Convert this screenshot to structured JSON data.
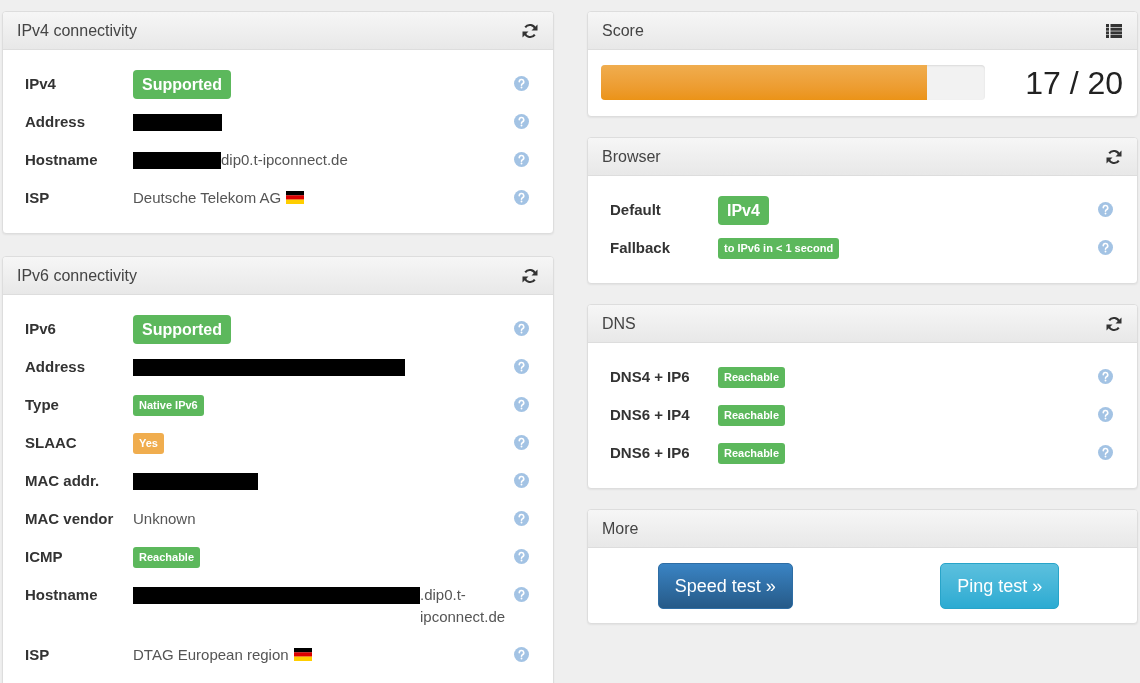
{
  "columns": [
    {
      "panels": [
        {
          "title": "IPv4 connectivity",
          "kind": "test",
          "rows": [
            {
              "label": "IPv4",
              "kind": "status",
              "value": "Supported",
              "color": "#5cb85c"
            },
            {
              "label": "Address",
              "kind": "masked"
            },
            {
              "label": "Hostname",
              "kind": "masked",
              "value": "dip0.t-ipconnect.de"
            },
            {
              "label": "ISP",
              "kind": "country",
              "value": "Deutsche Telekom AG"
            }
          ]
        },
        {
          "title": "IPv6 connectivity",
          "kind": "test",
          "rows": [
            {
              "label": "IPv6",
              "kind": "status",
              "value": "Supported",
              "color": "#5cb85c"
            },
            {
              "label": "Address",
              "kind": "masked"
            },
            {
              "label": "Type",
              "kind": "tag",
              "value": "Native IPv6",
              "color": "#5cb85c"
            },
            {
              "label": "SLAAC",
              "kind": "tag",
              "value": "Yes",
              "color": "#f0ad4e"
            },
            {
              "label": "MAC addr.",
              "kind": "masked"
            },
            {
              "label": "MAC vendor",
              "kind": "text",
              "value": "Unknown"
            },
            {
              "label": "ICMP",
              "kind": "tag",
              "value": "Reachable",
              "color": "#5cb85c"
            },
            {
              "label": "Hostname",
              "kind": "masked",
              "value": ".dip0.t-ipconnect.de"
            },
            {
              "label": "ISP",
              "kind": "country",
              "value": "DTAG European region"
            }
          ]
        }
      ]
    },
    {
      "panels": [
        {
          "title": "Score",
          "kind": "score",
          "level": 0.85,
          "score": "17 / 20"
        },
        {
          "title": "Browser",
          "kind": "test",
          "rows": [
            {
              "label": "Default",
              "kind": "status",
              "value": "IPv4",
              "color": "#5cb85c"
            },
            {
              "label": "Fallback",
              "kind": "tag",
              "value": "to IPv6 in < 1 second",
              "color": "#5cb85c"
            }
          ]
        },
        {
          "title": "DNS",
          "kind": "test",
          "rows": [
            {
              "label": "DNS4 + IP6",
              "kind": "tag",
              "value": "Reachable",
              "color": "#5cb85c"
            },
            {
              "label": "DNS6 + IP4",
              "kind": "tag",
              "value": "Reachable",
              "color": "#5cb85c"
            },
            {
              "label": "DNS6 + IP6",
              "kind": "tag",
              "value": "Reachable",
              "color": "#5cb85c"
            }
          ]
        },
        {
          "title": "More",
          "kind": "links",
          "buttons": [
            {
              "label": "Speed test »",
              "kind": "primary"
            },
            {
              "label": "Ping test »",
              "kind": "info"
            }
          ]
        }
      ]
    }
  ]
}
